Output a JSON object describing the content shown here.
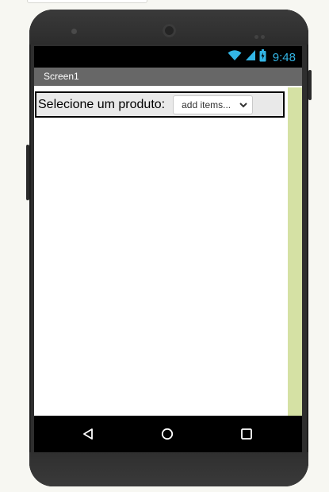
{
  "status_bar": {
    "time": "9:48",
    "icons": [
      "wifi-icon",
      "signal-icon",
      "battery-icon"
    ]
  },
  "title_bar": {
    "title": "Screen1"
  },
  "form": {
    "label": "Selecione um produto:",
    "spinner": {
      "selected": "add items...",
      "icon": "chevron-down-icon"
    }
  },
  "navigation": {
    "icons": [
      "back-icon",
      "home-icon",
      "recents-icon"
    ]
  },
  "colors": {
    "status_accent": "#33b5e5",
    "title_bar": "#676767",
    "row_background": "#e9e9e9",
    "right_strip": "#d5e1a4",
    "phone_body": "#2e2e2e"
  }
}
